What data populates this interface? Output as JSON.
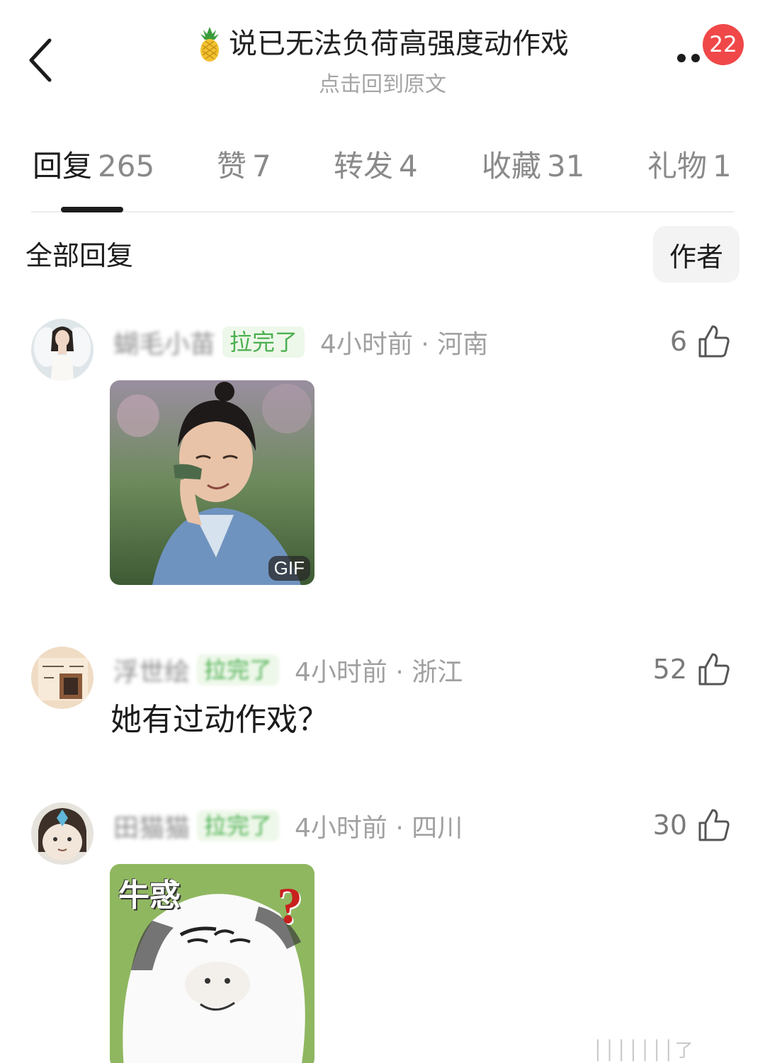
{
  "header": {
    "title": "说已无法负荷高强度动作戏",
    "subtitle": "点击回到原文",
    "badge_count": "22",
    "title_icon": "pineapple-icon"
  },
  "tabs": [
    {
      "label": "回复",
      "count": "265",
      "active": true
    },
    {
      "label": "赞",
      "count": "7",
      "active": false
    },
    {
      "label": "转发",
      "count": "4",
      "active": false
    },
    {
      "label": "收藏",
      "count": "31",
      "active": false
    },
    {
      "label": "礼物",
      "count": "1",
      "active": false
    }
  ],
  "filter": {
    "title": "全部回复",
    "author_button": "作者"
  },
  "comments": [
    {
      "username": "蝴毛小苗",
      "tag": "拉完了",
      "time_location": "4小时前 · 河南",
      "likes": "6",
      "media_badge": "GIF"
    },
    {
      "username": "浮世绘",
      "tag": "拉完了",
      "time_location": "4小时前 · 浙江",
      "likes": "52",
      "text": "她有过动作戏？"
    },
    {
      "username": "田猫猫",
      "tag": "拉完了",
      "time_location": "4小时前 · 四川",
      "likes": "30",
      "meme_caption": "牛惑",
      "meme_mark": "?"
    }
  ],
  "watermark": "│││││││了",
  "colors": {
    "badge": "#f04848",
    "tag_green": "#4caf50",
    "tag_bg": "#eef8ea",
    "muted": "#a0a0a0"
  }
}
